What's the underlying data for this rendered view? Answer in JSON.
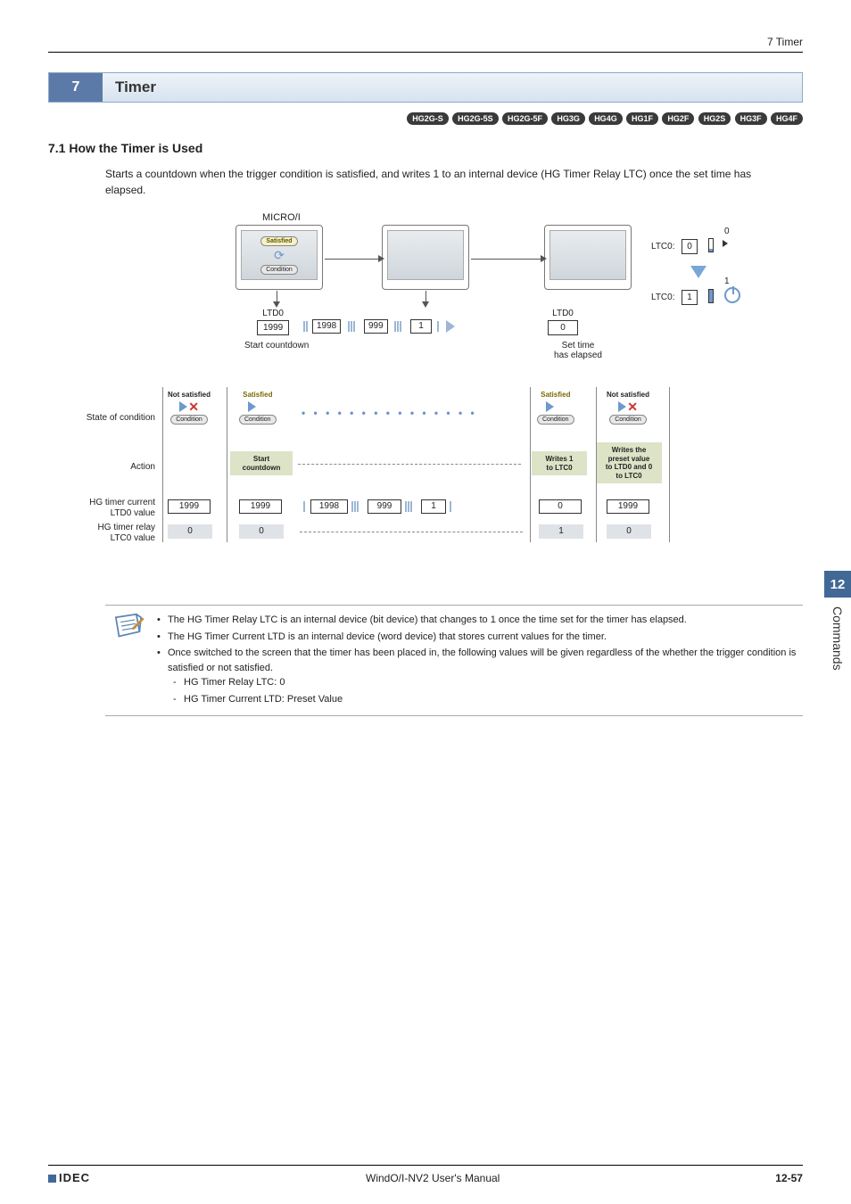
{
  "header": {
    "right": "7 Timer"
  },
  "banner": {
    "num": "7",
    "title": "Timer"
  },
  "badges": [
    "HG2G-S",
    "HG2G-5S",
    "HG2G-5F",
    "HG3G",
    "HG4G",
    "HG1F",
    "HG2F",
    "HG2S",
    "HG3F",
    "HG4F"
  ],
  "subhead": "7.1   How the Timer is Used",
  "intro": "Starts a countdown when the trigger condition is satisfied, and writes 1 to an internal device (HG Timer Relay LTC) once the set time has elapsed.",
  "diagram": {
    "micro": "MICRO/I",
    "satisfied": "Satisfied",
    "not_satisfied": "Not satisfied",
    "condition": "Condition",
    "ltd0": "LTD0",
    "ltc0": "LTC0:",
    "ltc_box0": "0",
    "ltc_side0": "0",
    "ltc_box1": "1",
    "ltc_side1": "1",
    "seq": {
      "a": "1999",
      "b": "1998",
      "c": "999",
      "d": "1",
      "e": "0"
    },
    "start_countdown": "Start countdown",
    "set_time": "Set time\nhas elapsed",
    "row_state": "State of condition",
    "row_action": "Action",
    "row_ltd": "HG timer current\nLTD0 value",
    "row_ltc": "HG timer relay\nLTC0 value",
    "act_start": "Start\ncountdown",
    "act_write": "Writes 1\nto LTC0",
    "act_preset": "Writes the\npreset value\nto LTD0 and 0\nto LTC0",
    "ltd_row": {
      "a": "1999",
      "b": "1999",
      "c": "1998",
      "d": "999",
      "e": "1",
      "f": "0",
      "g": "1999"
    },
    "ltc_row": {
      "a": "0",
      "b": "0",
      "c": "1",
      "d": "0"
    }
  },
  "notes": {
    "b1": "The HG Timer Relay LTC is an internal device (bit device) that changes to 1 once the time set for the timer has elapsed.",
    "b2": "The HG Timer Current LTD is an internal device (word device) that stores current values for the timer.",
    "b3": "Once switched to the screen that the timer has been placed in, the following values will be given regardless of the whether the trigger condition is satisfied or not satisfied.",
    "s1": "HG Timer Relay LTC: 0",
    "s2": "HG Timer Current LTD: Preset Value"
  },
  "sidetab": {
    "num": "12",
    "label": "Commands"
  },
  "footer": {
    "brand": "IDEC",
    "center": "WindO/I-NV2 User's Manual",
    "page": "12-57"
  }
}
